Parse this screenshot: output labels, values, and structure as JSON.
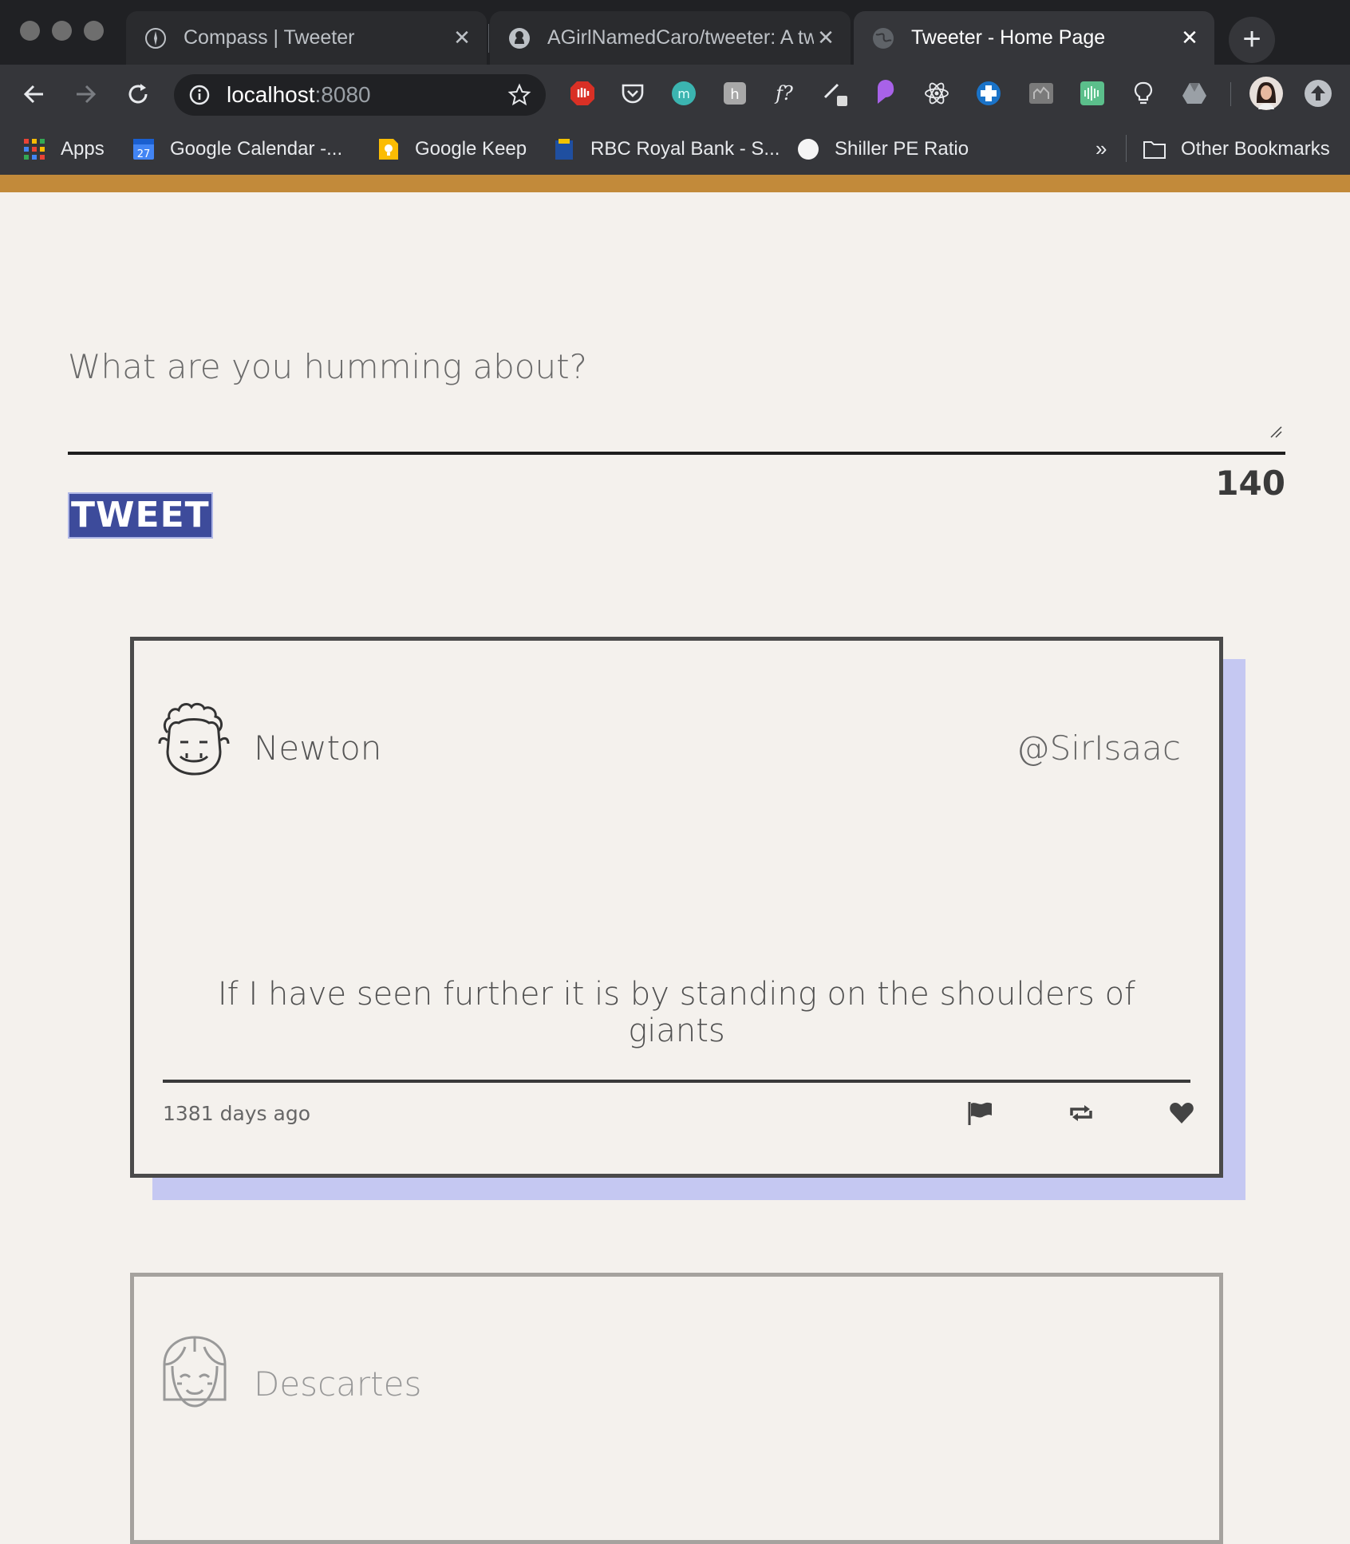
{
  "browser": {
    "tabs": [
      {
        "title": "Compass | Tweeter",
        "close": "✕"
      },
      {
        "title": "AGirlNamedCaro/tweeter: A tw",
        "close": "✕"
      },
      {
        "title": "Tweeter - Home Page",
        "close": "✕"
      }
    ],
    "new_tab": "+",
    "url_host": "localhost",
    "url_port": ":8080",
    "bookmarks": [
      {
        "label": "Apps"
      },
      {
        "label": "Google Calendar -..."
      },
      {
        "label": "Google Keep"
      },
      {
        "label": "RBC Royal Bank - S..."
      },
      {
        "label": "Shiller PE Ratio"
      }
    ],
    "overflow": "»",
    "other_bookmarks": "Other Bookmarks",
    "calendar_day": "27",
    "accent_color": "#c28a3a"
  },
  "compose": {
    "placeholder": "What are you humming about?",
    "button_label": "TWEET",
    "counter": "140"
  },
  "tweets": [
    {
      "name": "Newton",
      "handle": "@SirIsaac",
      "text": "If I have seen further it is by standing on the shoulders of giants",
      "time": "1381 days ago",
      "actions": [
        "flag-icon",
        "retweet-icon",
        "heart-icon"
      ]
    },
    {
      "name": "Descartes"
    }
  ]
}
